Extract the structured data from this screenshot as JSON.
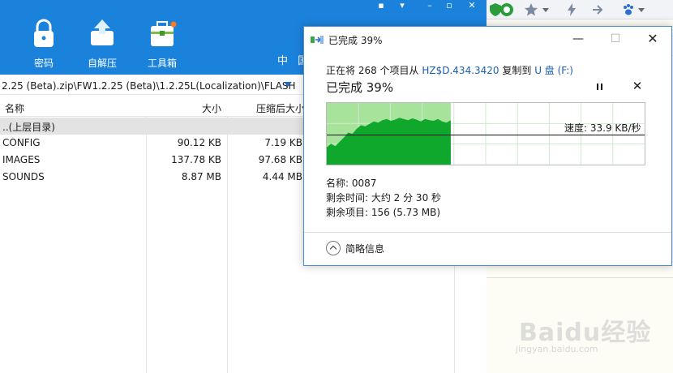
{
  "zip_app": {
    "toolbar": {
      "password_label": "密码",
      "selfextract_label": "自解压",
      "toolbox_label": "工具箱",
      "lang_label": "中 国"
    },
    "path": "2.25 (Beta).zip\\FW1.2.25 (Beta)\\1.2.25L(Localization)\\FLASH",
    "columns": {
      "name": "名称",
      "size": "大小",
      "compressed": "压缩后大小"
    },
    "rows": [
      {
        "name": "..(上层目录)",
        "size": "",
        "compressed": ""
      },
      {
        "name": "CONFIG",
        "size": "90.12 KB",
        "compressed": "7.19 KB"
      },
      {
        "name": "IMAGES",
        "size": "137.78 KB",
        "compressed": "97.68 KB"
      },
      {
        "name": "SOUNDS",
        "size": "8.87 MB",
        "compressed": "4.44 MB"
      }
    ]
  },
  "dialog": {
    "title": "已完成 39%",
    "copy_prefix": "正在将 268 个项目从 ",
    "source": "HZ$D.434.3420",
    "copy_middle": " 复制到 ",
    "destination": "U 盘 (F:)",
    "status": "已完成 39%",
    "progress_percent": 39,
    "speed": "速度: 33.9 KB/秒",
    "name_line": "名称: 0087",
    "time_left_line": "剩余时间: 大约 2 分 30 秒",
    "items_left_line": "剩余项目: 156 (5.73 MB)",
    "details_label": "简略信息",
    "speed_history": [
      0.28,
      0.34,
      0.3,
      0.37,
      0.44,
      0.52,
      0.5,
      0.58,
      0.64,
      0.62,
      0.66,
      0.7,
      0.68,
      0.72,
      0.74,
      0.71,
      0.73,
      0.76,
      0.74,
      0.72,
      0.75,
      0.73,
      0.7,
      0.74,
      0.72,
      0.71,
      0.74,
      0.7,
      0.68,
      0.72
    ]
  },
  "watermark": {
    "brand": "Baidu经验",
    "url": "jingyan.baidu.com"
  },
  "colors": {
    "toolbar_blue": "#1b82dc",
    "graph_fill": "#0fa82c",
    "graph_bg": "#a8e39c",
    "link_blue": "#1a5fb4"
  }
}
